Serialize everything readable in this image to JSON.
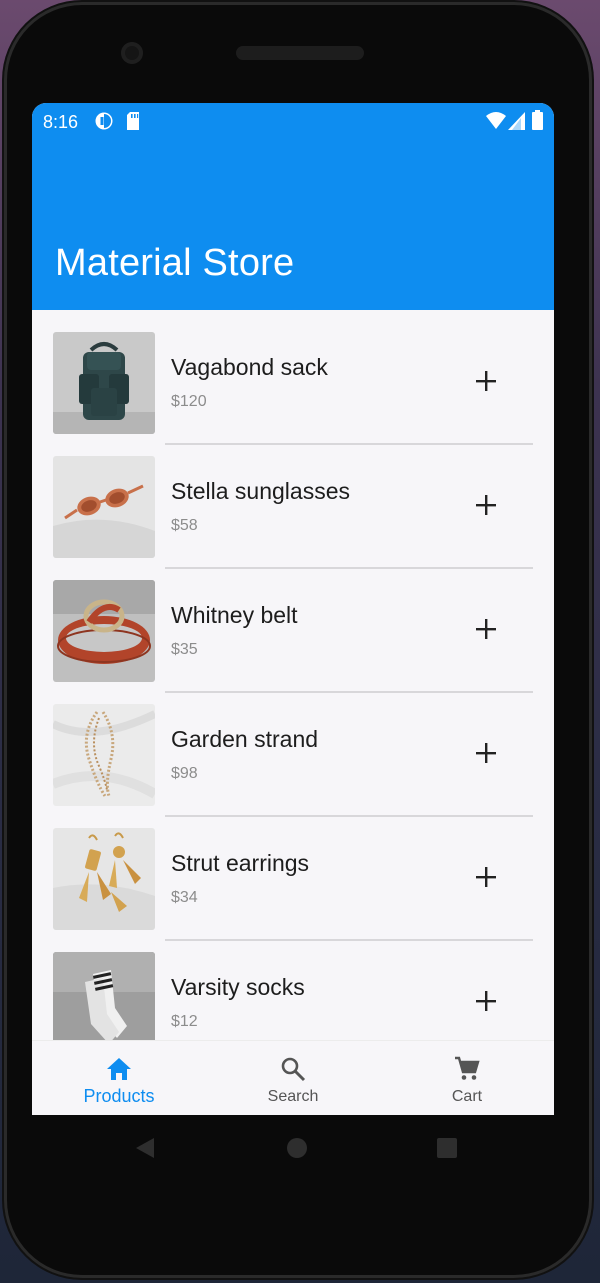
{
  "status": {
    "time": "8:16"
  },
  "appbar": {
    "title": "Material Store"
  },
  "products": [
    {
      "name": "Vagabond sack",
      "price": "$120"
    },
    {
      "name": "Stella sunglasses",
      "price": "$58"
    },
    {
      "name": "Whitney belt",
      "price": "$35"
    },
    {
      "name": "Garden strand",
      "price": "$98"
    },
    {
      "name": "Strut earrings",
      "price": "$34"
    },
    {
      "name": "Varsity socks",
      "price": "$12"
    }
  ],
  "nav": {
    "products": "Products",
    "search": "Search",
    "cart": "Cart",
    "active": "products",
    "active_color": "#0e8df0"
  },
  "colors": {
    "appbar": "#0e8df0",
    "background": "#f7f6f9"
  }
}
